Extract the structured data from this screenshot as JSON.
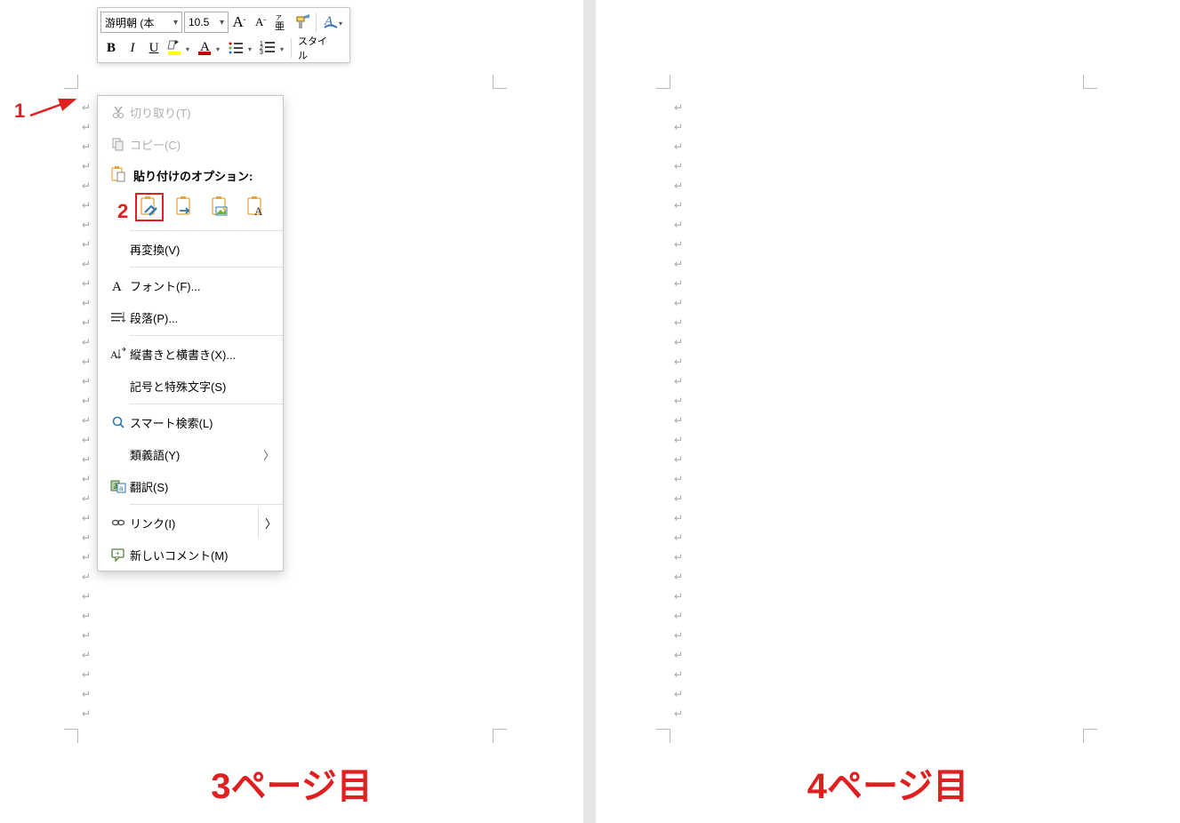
{
  "mini_toolbar": {
    "font_name": "游明朝 (本",
    "font_size": "10.5",
    "grow_font": "A",
    "shrink_font": "A",
    "phonetic": "ア亜",
    "format_painter": "format-painter",
    "bold": "B",
    "italic": "I",
    "underline": "U",
    "styles_label": "スタイル"
  },
  "context_menu": {
    "cut": "切り取り(T)",
    "copy": "コピー(C)",
    "paste_header": "貼り付けのオプション:",
    "reconvert": "再変換(V)",
    "font": "フォント(F)...",
    "paragraph": "段落(P)...",
    "text_direction": "縦書きと横書き(X)...",
    "symbols": "記号と特殊文字(S)",
    "smart_lookup": "スマート検索(L)",
    "synonyms": "類義語(Y)",
    "translate": "翻訳(S)",
    "link": "リンク(I)",
    "new_comment": "新しいコメント(M)"
  },
  "pages": {
    "left_label": "3ページ目",
    "right_label": "4ページ目"
  },
  "annotations": {
    "num1": "1",
    "num2": "2"
  },
  "paragraph_mark": "↵"
}
